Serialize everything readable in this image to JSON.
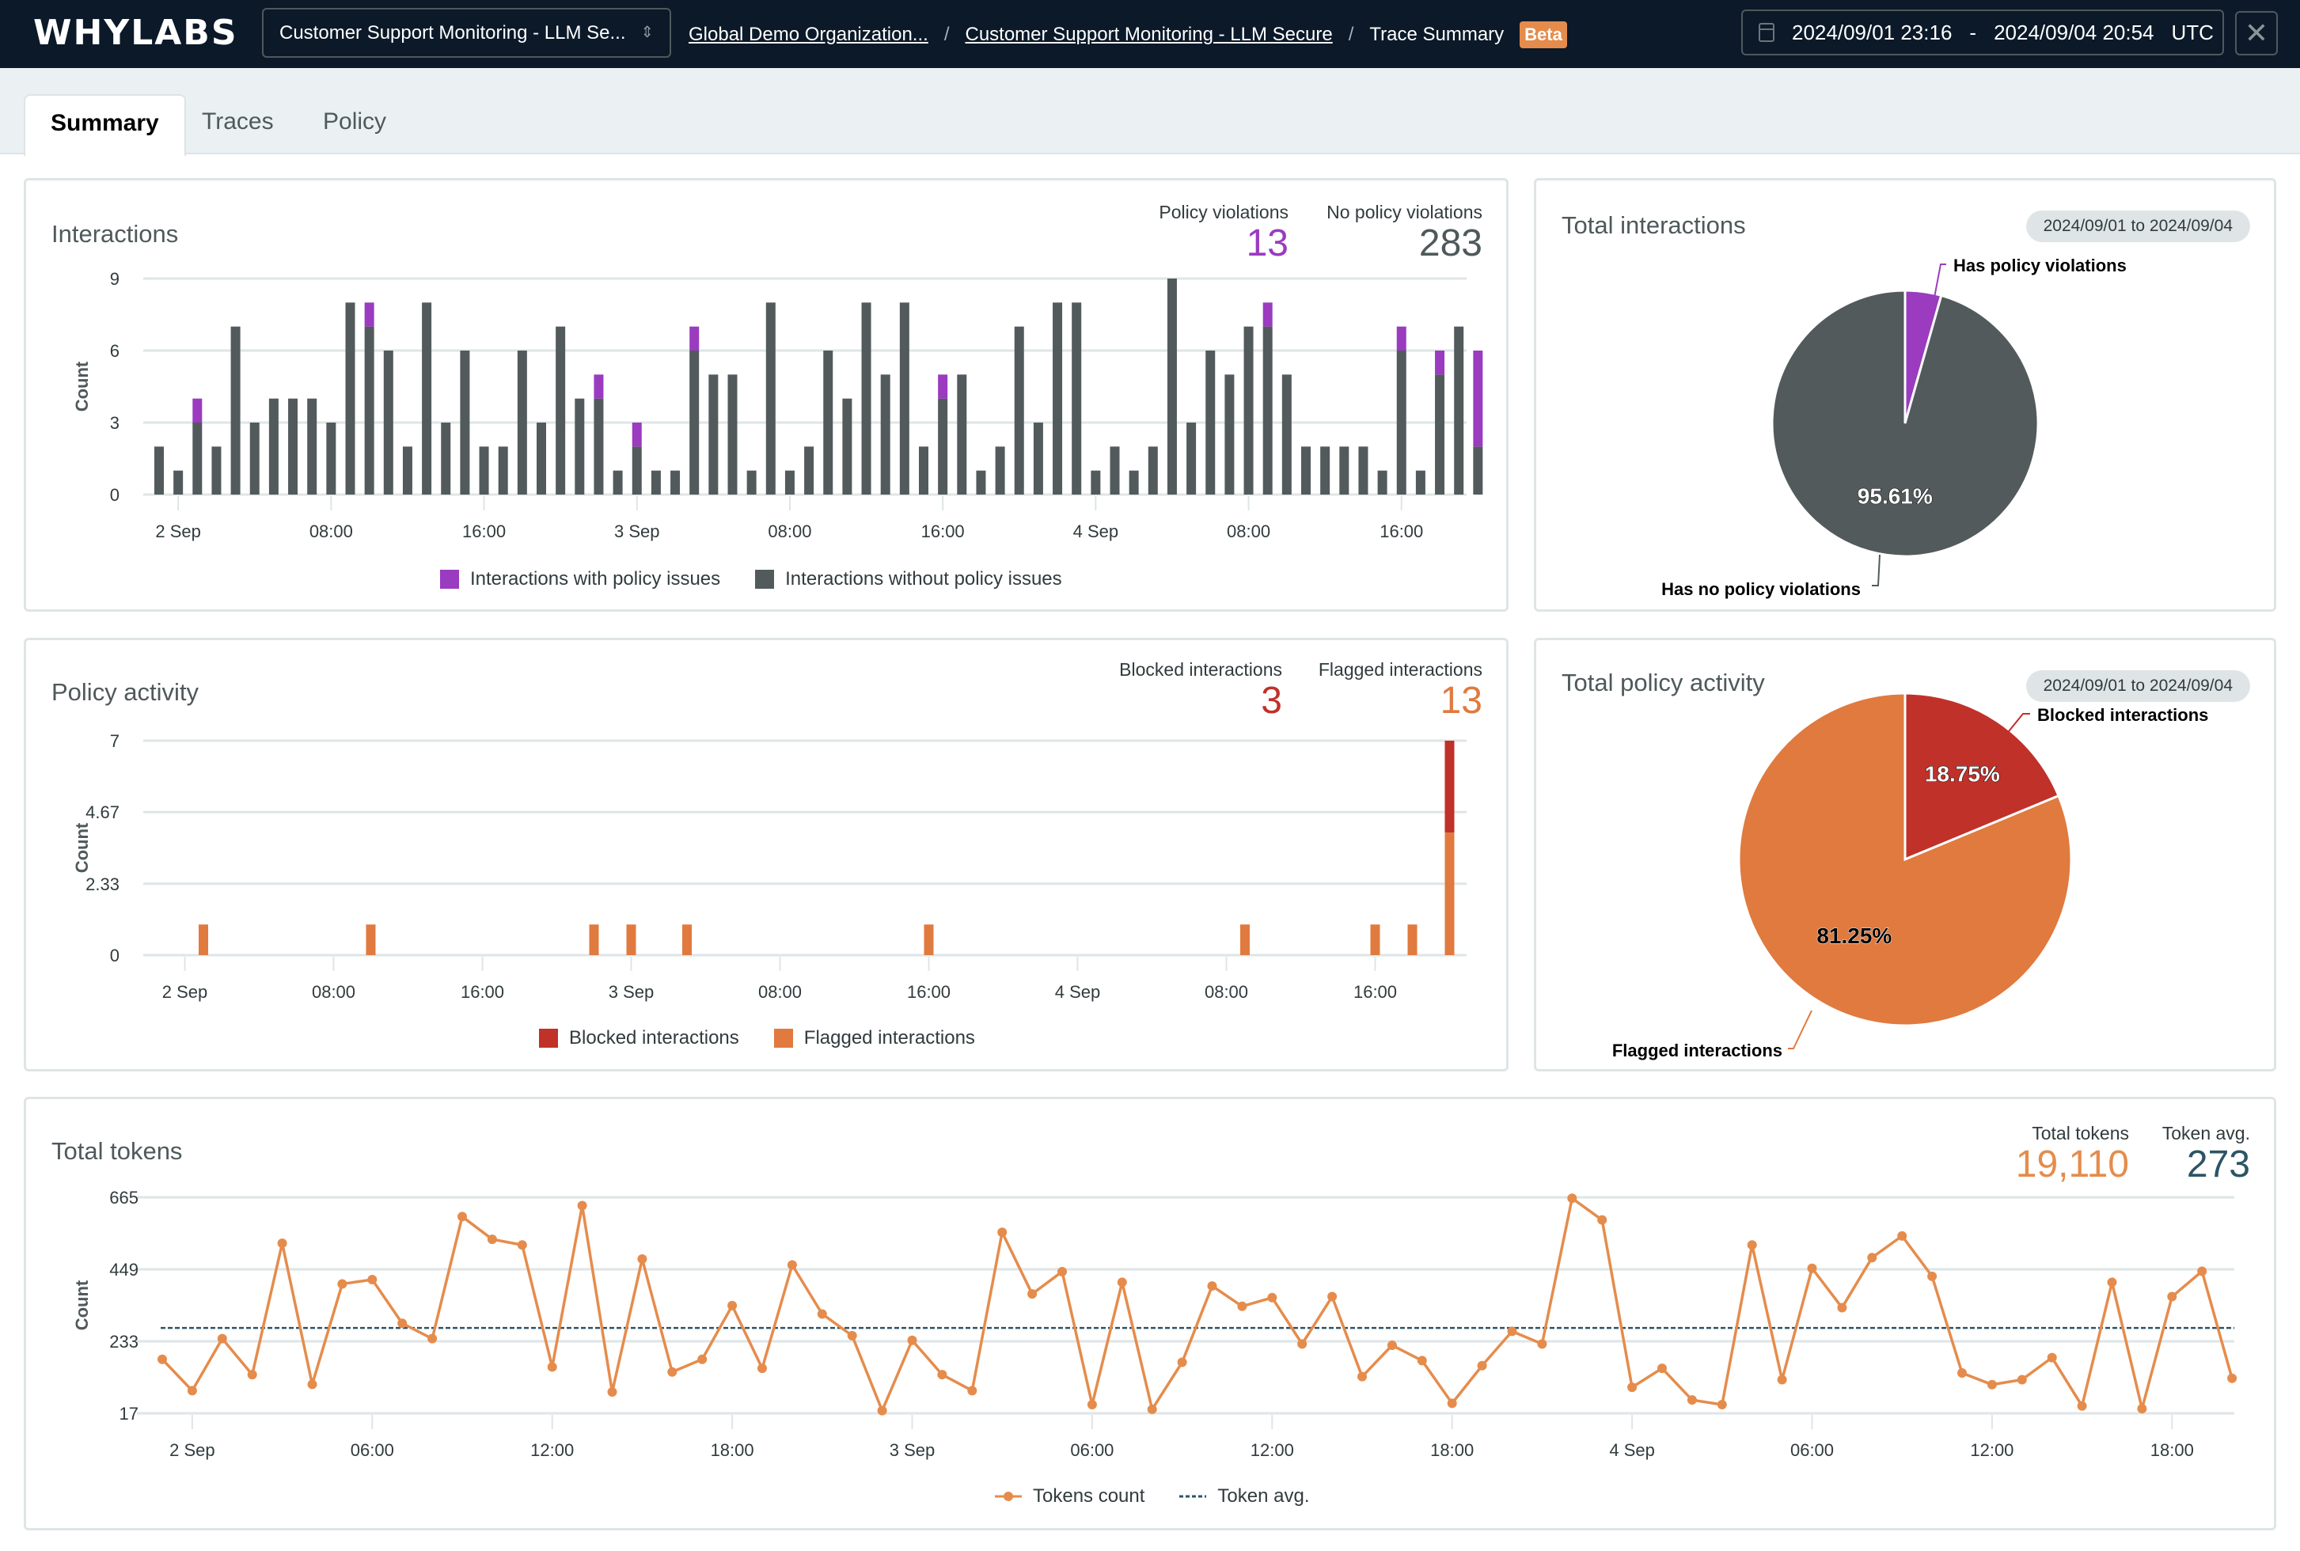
{
  "header": {
    "logo": "WHYLABS",
    "resource_select": "Customer Support Monitoring - LLM Se...",
    "breadcrumb": [
      "Global Demo Organization...",
      "Customer Support Monitoring - LLM Secure",
      "Trace Summary"
    ],
    "badge": "Beta",
    "date_start": "2024/09/01 23:16",
    "date_sep": "-",
    "date_end": "2024/09/04 20:54",
    "timezone": "UTC",
    "close_icon": "✕"
  },
  "tabs": [
    {
      "label": "Summary",
      "active": true
    },
    {
      "label": "Traces",
      "active": false
    },
    {
      "label": "Policy",
      "active": false
    }
  ],
  "colors": {
    "policy_issue": "#9a3bc0",
    "no_issue": "#525a5c",
    "blocked": "#c0312a",
    "flagged": "#e07a3f",
    "tokens": "#e58c4c",
    "token_avg": "#2c5466",
    "grid": "#dfe5e7"
  },
  "interactions_card": {
    "title": "Interactions",
    "metrics": [
      {
        "label": "Policy violations",
        "value": "13"
      },
      {
        "label": "No policy violations",
        "value": "283"
      }
    ]
  },
  "total_interactions_card": {
    "title": "Total interactions",
    "date_pill": "2024/09/01 to 2024/09/04"
  },
  "policy_activity_card": {
    "title": "Policy activity",
    "metrics": [
      {
        "label": "Blocked interactions",
        "value": "3"
      },
      {
        "label": "Flagged interactions",
        "value": "13"
      }
    ]
  },
  "total_policy_card": {
    "title": "Total policy activity",
    "date_pill": "2024/09/01 to 2024/09/04"
  },
  "tokens_card": {
    "title": "Total tokens",
    "metrics": [
      {
        "label": "Total tokens",
        "value": "19,110"
      },
      {
        "label": "Token avg.",
        "value": "273"
      }
    ]
  },
  "chart_data": [
    {
      "id": "interactions",
      "type": "bar",
      "stacked": true,
      "title": "Interactions",
      "xlabel": "",
      "ylabel": "Count",
      "ylim": [
        0,
        9
      ],
      "yticks": [
        0,
        3,
        6,
        9
      ],
      "x_start": "2024-09-01 23:00",
      "x_interval": "1 hour",
      "xticks": [
        {
          "label": "2 Sep",
          "hour": 1
        },
        {
          "label": "08:00",
          "hour": 9
        },
        {
          "label": "16:00",
          "hour": 17
        },
        {
          "label": "3 Sep",
          "hour": 25
        },
        {
          "label": "08:00",
          "hour": 33
        },
        {
          "label": "16:00",
          "hour": 41
        },
        {
          "label": "4 Sep",
          "hour": 49
        },
        {
          "label": "08:00",
          "hour": 57
        },
        {
          "label": "16:00",
          "hour": 65
        }
      ],
      "legend_position": "bottom",
      "series": [
        {
          "name": "Interactions without policy issues",
          "color": "#525a5c",
          "values": [
            2,
            1,
            3,
            2,
            7,
            3,
            4,
            4,
            4,
            3,
            8,
            7,
            6,
            2,
            8,
            3,
            6,
            2,
            2,
            6,
            3,
            7,
            4,
            4,
            1,
            2,
            1,
            1,
            6,
            5,
            5,
            1,
            8,
            1,
            2,
            6,
            4,
            8,
            5,
            8,
            2,
            4,
            5,
            1,
            2,
            7,
            3,
            8,
            8,
            1,
            2,
            1,
            2,
            9,
            3,
            6,
            5,
            7,
            7,
            5,
            2,
            2,
            2,
            2,
            1,
            6,
            1,
            5,
            7,
            2
          ]
        },
        {
          "name": "Interactions with policy issues",
          "color": "#9a3bc0",
          "values": [
            0,
            0,
            1,
            0,
            0,
            0,
            0,
            0,
            0,
            0,
            0,
            1,
            0,
            0,
            0,
            0,
            0,
            0,
            0,
            0,
            0,
            0,
            0,
            1,
            0,
            1,
            0,
            0,
            1,
            0,
            0,
            0,
            0,
            0,
            0,
            0,
            0,
            0,
            0,
            0,
            0,
            1,
            0,
            0,
            0,
            0,
            0,
            0,
            0,
            0,
            0,
            0,
            0,
            0,
            0,
            0,
            0,
            0,
            1,
            0,
            0,
            0,
            0,
            0,
            0,
            1,
            0,
            1,
            0,
            4
          ]
        }
      ]
    },
    {
      "id": "total-interactions-pie",
      "type": "pie",
      "title": "Total interactions",
      "slices": [
        {
          "label": "Has policy violations",
          "value": 13,
          "percent": 4.39,
          "color": "#9a3bc0",
          "show_pct": false
        },
        {
          "label": "Has no policy violations",
          "value": 283,
          "percent": 95.61,
          "pct_label": "95.61%",
          "color": "#525a5c",
          "show_pct": true
        }
      ]
    },
    {
      "id": "policy-activity",
      "type": "bar",
      "stacked": true,
      "title": "Policy activity",
      "ylabel": "Count",
      "ylim": [
        0,
        7
      ],
      "yticks": [
        "0",
        "2.33",
        "4.67",
        "7"
      ],
      "x_start": "2024-09-01 23:00",
      "x_interval": "1 hour",
      "xticks": [
        {
          "label": "2 Sep",
          "hour": 1
        },
        {
          "label": "08:00",
          "hour": 9
        },
        {
          "label": "16:00",
          "hour": 17
        },
        {
          "label": "3 Sep",
          "hour": 25
        },
        {
          "label": "08:00",
          "hour": 33
        },
        {
          "label": "16:00",
          "hour": 41
        },
        {
          "label": "4 Sep",
          "hour": 49
        },
        {
          "label": "08:00",
          "hour": 57
        },
        {
          "label": "16:00",
          "hour": 65
        }
      ],
      "legend_position": "bottom",
      "bars": [
        {
          "hour": 2,
          "flagged": 1,
          "blocked": 0
        },
        {
          "hour": 11,
          "flagged": 1,
          "blocked": 0
        },
        {
          "hour": 23,
          "flagged": 1,
          "blocked": 0
        },
        {
          "hour": 25,
          "flagged": 1,
          "blocked": 0
        },
        {
          "hour": 28,
          "flagged": 1,
          "blocked": 0
        },
        {
          "hour": 41,
          "flagged": 1,
          "blocked": 0
        },
        {
          "hour": 58,
          "flagged": 1,
          "blocked": 0
        },
        {
          "hour": 65,
          "flagged": 1,
          "blocked": 0
        },
        {
          "hour": 67,
          "flagged": 1,
          "blocked": 0
        },
        {
          "hour": 69,
          "flagged": 4,
          "blocked": 3
        }
      ],
      "series": [
        {
          "name": "Blocked interactions",
          "color": "#c0312a"
        },
        {
          "name": "Flagged interactions",
          "color": "#e07a3f"
        }
      ]
    },
    {
      "id": "total-policy-pie",
      "type": "pie",
      "title": "Total policy activity",
      "slices": [
        {
          "label": "Blocked interactions",
          "value": 3,
          "percent": 18.75,
          "pct_label": "18.75%",
          "color": "#c0312a",
          "show_pct": true
        },
        {
          "label": "Flagged interactions",
          "value": 13,
          "percent": 81.25,
          "pct_label": "81.25%",
          "color": "#e07a3f",
          "show_pct": true
        }
      ]
    },
    {
      "id": "total-tokens",
      "type": "line",
      "title": "Total tokens",
      "ylabel": "Count",
      "ylim": [
        17,
        665
      ],
      "yticks": [
        17,
        233,
        449,
        665
      ],
      "x_start": "2024-09-01 23:00",
      "x_interval": "1 hour",
      "xticks": [
        {
          "label": "2 Sep",
          "hour": 1
        },
        {
          "label": "06:00",
          "hour": 7
        },
        {
          "label": "12:00",
          "hour": 13
        },
        {
          "label": "18:00",
          "hour": 19
        },
        {
          "label": "3 Sep",
          "hour": 25
        },
        {
          "label": "06:00",
          "hour": 31
        },
        {
          "label": "12:00",
          "hour": 37
        },
        {
          "label": "18:00",
          "hour": 43
        },
        {
          "label": "4 Sep",
          "hour": 49
        },
        {
          "label": "06:00",
          "hour": 55
        },
        {
          "label": "12:00",
          "hour": 61
        },
        {
          "label": "18:00",
          "hour": 67
        }
      ],
      "legend_position": "bottom",
      "series": [
        {
          "name": "Tokens count",
          "color": "#e58c4c",
          "values": [
            179,
            85,
            241,
            133,
            527,
            104,
            405,
            418,
            287,
            241,
            607,
            539,
            522,
            156,
            640,
            81,
            480,
            141,
            179,
            340,
            152,
            462,
            315,
            250,
            25,
            236,
            133,
            85,
            560,
            375,
            442,
            43,
            410,
            29,
            170,
            399,
            338,
            364,
            225,
            367,
            127,
            221,
            175,
            47,
            160,
            263,
            225,
            662,
            597,
            95,
            152,
            57,
            43,
            522,
            118,
            452,
            334,
            484,
            549,
            428,
            138,
            103,
            118,
            184,
            39,
            410,
            31,
            367,
            443,
            122
          ]
        },
        {
          "name": "Token avg.",
          "color": "#2c5466",
          "dashed": true,
          "value": 273
        }
      ]
    }
  ]
}
